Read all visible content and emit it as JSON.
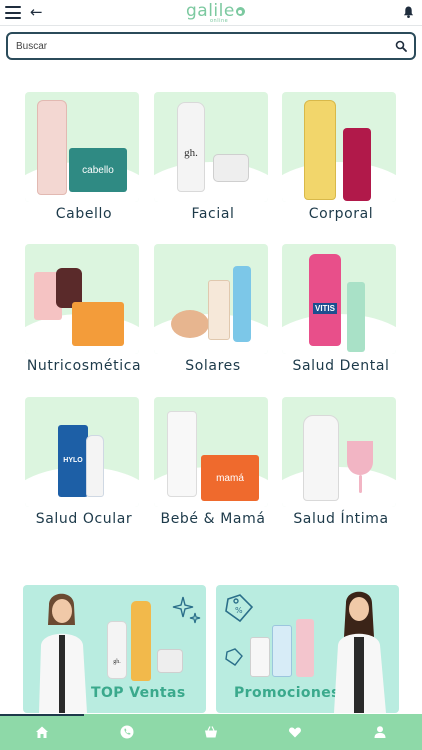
{
  "header": {
    "menu_icon": "hamburger-menu-icon",
    "back_icon": "arrow-left-icon",
    "back_glyph": "←",
    "logo_text": "galile",
    "logo_sub": "online",
    "notification_icon": "bell-icon"
  },
  "search": {
    "placeholder": "Buscar",
    "icon": "search-icon"
  },
  "categories": [
    {
      "label": "Cabello"
    },
    {
      "label": "Facial"
    },
    {
      "label": "Corporal"
    },
    {
      "label": "Nutricosmética"
    },
    {
      "label": "Solares"
    },
    {
      "label": "Salud Dental"
    },
    {
      "label": "Salud Ocular"
    },
    {
      "label": "Bebé & Mamá"
    },
    {
      "label": "Salud Íntima"
    }
  ],
  "product_texts": {
    "cabello_box": "cabello",
    "facial_brand": "gh.",
    "dental_brand": "VITIS",
    "ocular_brand": "HYLO",
    "bebe_box": "mamá"
  },
  "banners": {
    "top_sales_label": "TOP Ventas",
    "promotions_label": "Promociones",
    "banner_brand": "gh."
  },
  "bottom_nav": [
    {
      "name": "home",
      "icon": "home-icon"
    },
    {
      "name": "phone",
      "icon": "phone-icon"
    },
    {
      "name": "basket",
      "icon": "basket-icon"
    },
    {
      "name": "favorites",
      "icon": "heart-icon"
    },
    {
      "name": "account",
      "icon": "user-icon"
    }
  ],
  "colors": {
    "accent_green": "#8ed9a8",
    "card_bg": "#dcf5df",
    "banner_bg": "#b9ece0",
    "text_dark": "#1d3a4a",
    "logo_green": "#7cc9a0"
  }
}
